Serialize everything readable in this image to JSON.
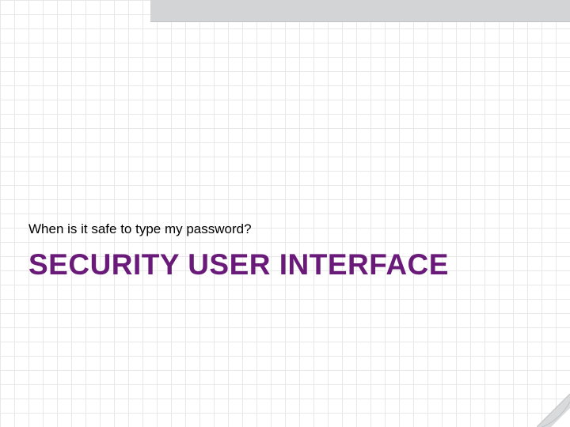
{
  "slide": {
    "subtitle": "When is it safe to type my password?",
    "title": "SECURITY USER INTERFACE"
  },
  "colors": {
    "title_color": "#6a1b7a",
    "band_color": "#d2d4d6",
    "grid_color": "#e8e8e8"
  }
}
